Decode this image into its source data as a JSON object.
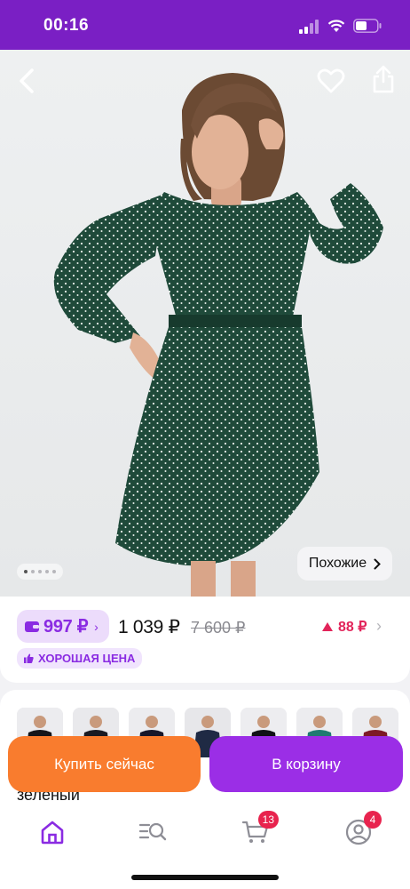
{
  "status_bar": {
    "time": "00:16"
  },
  "gallery": {
    "page_count": 5,
    "current_page": 1,
    "similar_label": "Похожие"
  },
  "price": {
    "wallet_price": "997 ₽",
    "regular_price": "1 039 ₽",
    "old_price": "7 600 ₽",
    "points": "88 ₽",
    "badge_label": "ХОРОШАЯ ЦЕНА"
  },
  "colors": {
    "swatches": [
      "black",
      "black",
      "black",
      "navy",
      "black",
      "teal",
      "burgundy"
    ],
    "selected_label": "зеленый"
  },
  "actions": {
    "buy_now": "Купить сейчас",
    "add_to_cart": "В корзину"
  },
  "bottom_nav": {
    "items": [
      {
        "icon": "home-icon",
        "active": true
      },
      {
        "icon": "catalog-search-icon",
        "active": false
      },
      {
        "icon": "cart-icon",
        "badge": "13"
      },
      {
        "icon": "profile-icon",
        "badge": "4"
      }
    ]
  },
  "theme": {
    "accent": "#8a2be2",
    "header": "#7a1fc4",
    "buy": "#f97c2e",
    "cart": "#9b2ee6",
    "badge": "#e8234e"
  }
}
